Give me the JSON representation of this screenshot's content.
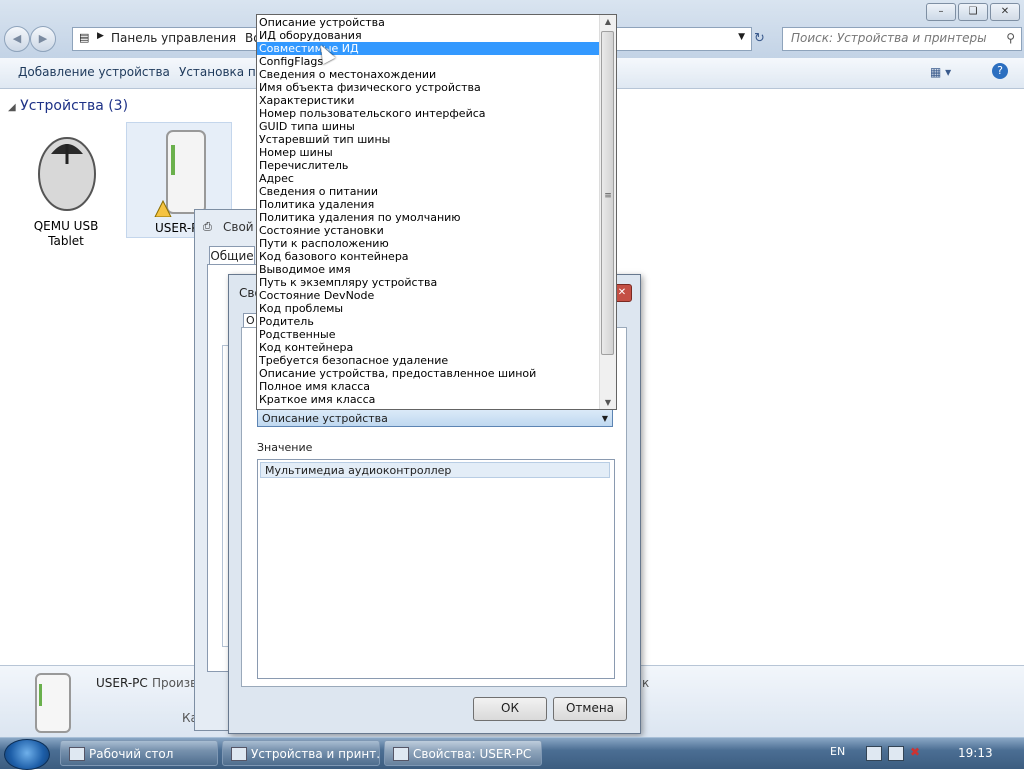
{
  "window": {
    "breadcrumb": "Панель управления",
    "breadcrumb_more": "Во",
    "search_placeholder": "Поиск: Устройства и принтеры",
    "toolbar": {
      "add_device": "Добавление устройства",
      "install_printer": "Установка при"
    },
    "group_title": "Устройства (3)",
    "devices": [
      {
        "name": "QEMU USB\nTablet",
        "icon": "mouse-icon"
      },
      {
        "name": "USER-P",
        "icon": "computer-icon"
      }
    ],
    "details": {
      "device_name": "USER-PC",
      "manufacturer_label": "Произв",
      "category_label": "Катего",
      "extra": "к"
    }
  },
  "back_dialog": {
    "title": "Свой",
    "tab": "Общие"
  },
  "front_dialog": {
    "title": "Сво",
    "tab_partial": "О",
    "selected_property": "Описание устройства",
    "value_label": "Значение",
    "value": "Мультимедиа аудиоконтроллер",
    "ok": "ОК",
    "cancel": "Отмена"
  },
  "dropdown": {
    "selected_index": 2,
    "options": [
      "Описание устройства",
      "ИД оборудования",
      "Совместимые ИД",
      "ConfigFlags",
      "Сведения о местонахождении",
      "Имя объекта физического устройства",
      "Характеристики",
      "Номер пользовательского интерфейса",
      "GUID типа шины",
      "Устаревший тип шины",
      "Номер шины",
      "Перечислитель",
      "Адрес",
      "Сведения о питании",
      "Политика удаления",
      "Политика удаления по умолчанию",
      "Состояние установки",
      "Пути к расположению",
      "Код базового контейнера",
      "Выводимое имя",
      "Путь к экземпляру устройства",
      "Состояние DevNode",
      "Код проблемы",
      "Родитель",
      "Родственные",
      "Код контейнера",
      "Требуется безопасное удаление",
      "Описание устройства, предоставленное шиной",
      "Полное имя класса",
      "Краткое имя класса"
    ]
  },
  "taskbar": {
    "items": [
      "Рабочий стол",
      "Устройства и принт...",
      "Свойства: USER-PC"
    ],
    "lang": "EN",
    "clock": "19:13"
  }
}
